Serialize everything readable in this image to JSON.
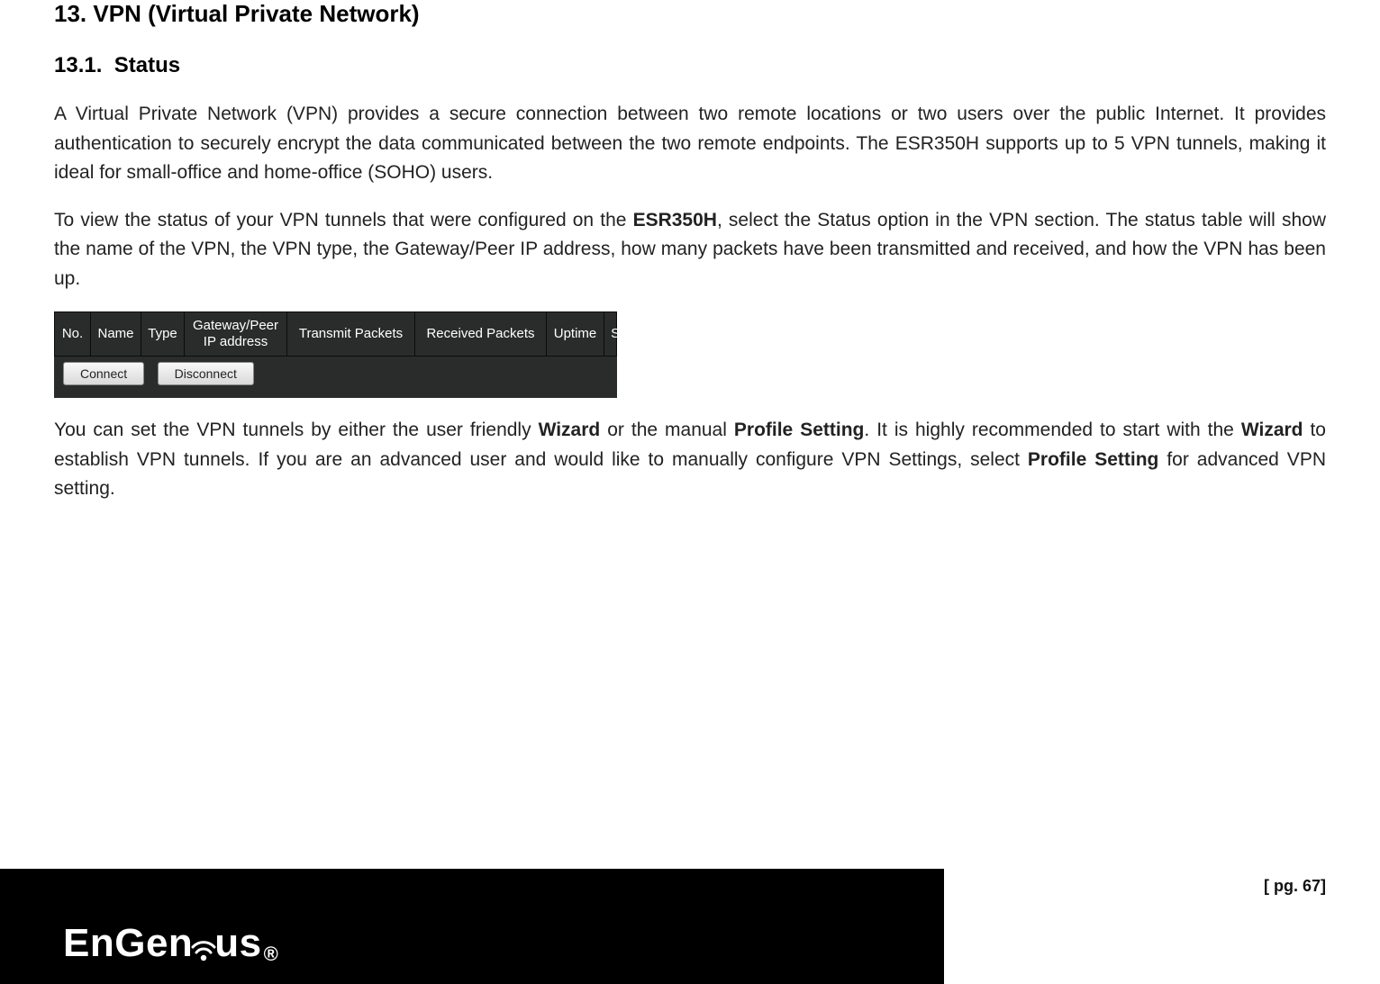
{
  "section": {
    "number": "13.",
    "title": "VPN (Virtual Private Network)"
  },
  "subsection": {
    "number": "13.1.",
    "title": "Status"
  },
  "paragraphs": {
    "p1": "A Virtual Private Network (VPN) provides a secure connection between two remote locations or two users over the public Internet. It provides authentication to securely encrypt the data communicated between the two remote endpoints. The ESR350H supports up to 5 VPN tunnels, making it ideal for small-office and home-office (SOHO) users.",
    "p2a": "To view the status of your VPN tunnels that were configured on the ",
    "p2b": "ESR350H",
    "p2c": ", select the Status option in the VPN section. The status table will show the name of the VPN, the VPN type, the Gateway/Peer IP address, how many packets have been transmitted and received, and how the VPN has been up.",
    "p3a": "You can set the VPN tunnels by either the user friendly ",
    "p3b": "Wizard",
    "p3c": " or the manual ",
    "p3d": "Profile Setting",
    "p3e": ". It is highly recommended to start with the ",
    "p3f": "Wizard",
    "p3g": " to establish VPN tunnels. If you are an advanced user and would like to manually configure VPN Settings, select ",
    "p3h": "Profile Setting",
    "p3i": " for advanced VPN setting."
  },
  "table": {
    "headers": {
      "no": "No.",
      "name": "Name",
      "type": "Type",
      "gateway": "Gateway/Peer IP address",
      "tx": "Transmit Packets",
      "rx": "Received Packets",
      "uptime": "Uptime",
      "select": "Select"
    },
    "buttons": {
      "connect": "Connect",
      "disconnect": "Disconnect"
    }
  },
  "footer": {
    "brand_pre": "EnGen",
    "brand_post": "us",
    "page_label": "[ pg. 67]"
  }
}
